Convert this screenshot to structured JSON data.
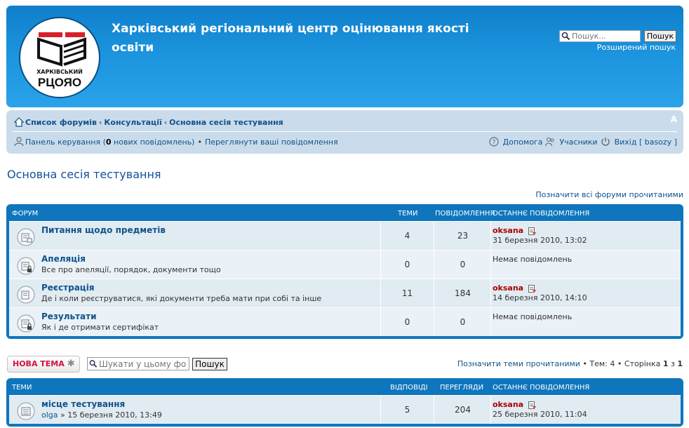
{
  "header": {
    "logo_sub": "ХАРКІВСЬКИЙ",
    "logo_main": "РЦОЯО",
    "site_title": "Харківський регіональний центр оцінювання якості освіти",
    "search_placeholder": "Пошук...",
    "search_button": "Пошук",
    "advanced_search": "Розширений пошук"
  },
  "breadcrumbs": {
    "home": "Список форумів",
    "sep": "‹",
    "level1": "Консультації",
    "level2": "Основна сесія тестування",
    "font_size": "A"
  },
  "nav": {
    "control_panel": "Панель керування (",
    "new_count": "0",
    "new_messages": " нових повідомлень)",
    "bullet": "•",
    "view_posts": "Переглянути ваші повідомлення",
    "help": "Допомога",
    "members": "Учасники",
    "logout": "Вихід [ basozy ]"
  },
  "page": {
    "title": "Основна сесія тестування",
    "mark_all_read": "Позначити всі форуми прочитаними"
  },
  "forum_table": {
    "headers": {
      "forum": "Форум",
      "topics": "Теми",
      "posts": "Повідомлення",
      "last_post": "Останнє повідомлення"
    },
    "rows": [
      {
        "title": "Питання щодо предметів",
        "desc": "",
        "topics": "4",
        "posts": "23",
        "last_user": "oksana",
        "last_date": "31 березня 2010, 13:02",
        "no_posts": ""
      },
      {
        "title": "Апеляція",
        "desc": "Все про апеляції, порядок, документи тощо",
        "topics": "0",
        "posts": "0",
        "last_user": "",
        "last_date": "",
        "no_posts": "Немає повідомлень"
      },
      {
        "title": "Реєстрація",
        "desc": "Де і коли реєструватися, які документи треба мати при собі та інше",
        "topics": "11",
        "posts": "184",
        "last_user": "oksana",
        "last_date": "14 березня 2010, 14:10",
        "no_posts": ""
      },
      {
        "title": "Результати",
        "desc": "Як і де отримати сертифікат",
        "topics": "0",
        "posts": "0",
        "last_user": "",
        "last_date": "",
        "no_posts": "Немає повідомлень"
      }
    ]
  },
  "topic_bar": {
    "new_topic": "НОВА ТЕМА",
    "search_placeholder": "Шукати у цьому фо",
    "search_button": "Пошук",
    "mark_topics_read": "Позначити теми прочитаними",
    "topics_count": " • Тем: 4 • Сторінка ",
    "page_current": "1",
    "page_of": " з ",
    "page_total": "1"
  },
  "topic_table": {
    "headers": {
      "topics": "Теми",
      "replies": "Відповіді",
      "views": "Перегляди",
      "last_post": "Останнє повідомлення"
    },
    "rows": [
      {
        "title": "місце тестування",
        "author": "olga",
        "date": "» 15 березня 2010, 13:49",
        "replies": "5",
        "views": "204",
        "last_user": "oksana",
        "last_date": "25 березня 2010, 11:04"
      }
    ]
  },
  "colors": {
    "header_blue": "#1b93dd",
    "nav_bg": "#cadceb",
    "link": "#105289",
    "user_red": "#aa0000",
    "new_topic_red": "#d31141"
  }
}
